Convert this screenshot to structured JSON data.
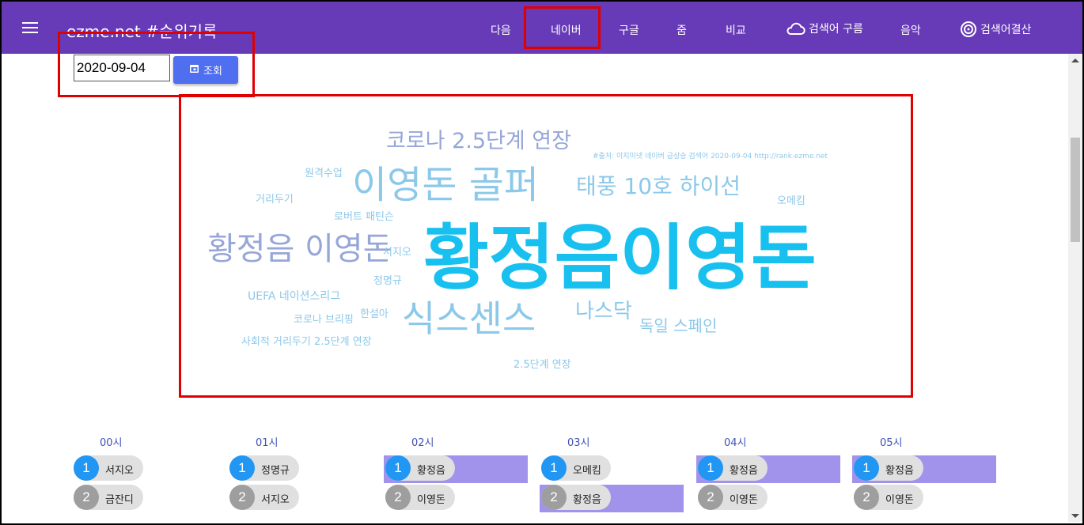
{
  "header": {
    "title": "ezme.net #순위기록"
  },
  "nav": [
    {
      "label": "다음"
    },
    {
      "label": "네이버"
    },
    {
      "label": "구글"
    },
    {
      "label": "줌"
    },
    {
      "label": "비교"
    },
    {
      "label": "검색어 구름",
      "icon": "cloud-icon"
    },
    {
      "label": "음악"
    },
    {
      "label": "검색어결산",
      "icon": "music-swirl-icon"
    }
  ],
  "date_form": {
    "date_value": "2020-09-04",
    "button_label": "조회",
    "button_icon": "calendar-icon"
  },
  "word_cloud": {
    "source_note": "#출처: 이지미넷 네이버 급상승 검색어 2020-09-04 http://rank.ezme.net",
    "words": [
      {
        "text": "황정음이영돈",
        "color": "#18c0f0"
      },
      {
        "text": "이영돈 골퍼",
        "color": "#8cc8ea"
      },
      {
        "text": "식스센스",
        "color": "#8cc8ea"
      },
      {
        "text": "황정음 이영돈",
        "color": "#96a6d8"
      },
      {
        "text": "태풍 10호 하이선",
        "color": "#8cc8ea"
      },
      {
        "text": "코로나 2.5단계 연장",
        "color": "#96a6d8"
      },
      {
        "text": "나스닥",
        "color": "#8cc8ea"
      },
      {
        "text": "독일 스페인",
        "color": "#8cc8ea"
      },
      {
        "text": "UEFA 네이션스리그",
        "color": "#8cc8ea"
      },
      {
        "text": "로버트 패틴슨",
        "color": "#8cc8ea"
      },
      {
        "text": "원격수업",
        "color": "#8cc8ea"
      },
      {
        "text": "거리두기",
        "color": "#8cc8ea"
      },
      {
        "text": "오메킴",
        "color": "#8cc8ea"
      },
      {
        "text": "서지오",
        "color": "#8cc8ea"
      },
      {
        "text": "정명규",
        "color": "#8cc8ea"
      },
      {
        "text": "코로나 브리핑",
        "color": "#8cc8ea"
      },
      {
        "text": "한설아",
        "color": "#8cc8ea"
      },
      {
        "text": "사회적 거리두기 2.5단계 연장",
        "color": "#8cc8ea"
      },
      {
        "text": "2.5단계 연장",
        "color": "#8cc8ea"
      }
    ]
  },
  "colors": {
    "header": "#673ab7",
    "highlight": "#e00000",
    "rank_highlight": "#a193ec",
    "rank1": "#2196f3",
    "rank_other": "#9e9e9e"
  },
  "hourly": [
    {
      "hour": "00시",
      "items": [
        {
          "rank": "1",
          "text": "서지오"
        },
        {
          "rank": "2",
          "text": "금잔디"
        }
      ]
    },
    {
      "hour": "01시",
      "items": [
        {
          "rank": "1",
          "text": "정명규"
        },
        {
          "rank": "2",
          "text": "서지오"
        }
      ]
    },
    {
      "hour": "02시",
      "items": [
        {
          "rank": "1",
          "text": "황정음",
          "highlight": true
        },
        {
          "rank": "2",
          "text": "이영돈"
        }
      ]
    },
    {
      "hour": "03시",
      "items": [
        {
          "rank": "1",
          "text": "오메킴"
        },
        {
          "rank": "2",
          "text": "황정음",
          "highlight": true
        }
      ]
    },
    {
      "hour": "04시",
      "items": [
        {
          "rank": "1",
          "text": "황정음",
          "highlight": true
        },
        {
          "rank": "2",
          "text": "이영돈"
        }
      ]
    },
    {
      "hour": "05시",
      "items": [
        {
          "rank": "1",
          "text": "황정음",
          "highlight": true
        },
        {
          "rank": "2",
          "text": "이영돈"
        }
      ]
    }
  ]
}
